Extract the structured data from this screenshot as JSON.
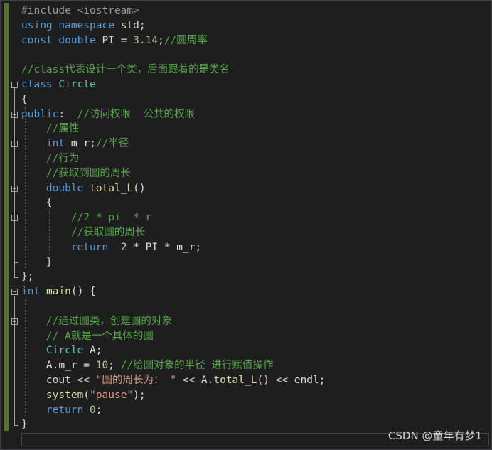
{
  "code_lines": [
    [
      {
        "t": "#include <iostream>",
        "c": "pp"
      }
    ],
    [
      {
        "t": "using",
        "c": "kw"
      },
      {
        "t": " ",
        "c": "tx"
      },
      {
        "t": "namespace",
        "c": "kw"
      },
      {
        "t": " std;",
        "c": "tx"
      }
    ],
    [
      {
        "t": "const",
        "c": "kw"
      },
      {
        "t": " ",
        "c": "tx"
      },
      {
        "t": "double",
        "c": "kw"
      },
      {
        "t": " PI = ",
        "c": "tx"
      },
      {
        "t": "3.14",
        "c": "nu"
      },
      {
        "t": ";",
        "c": "tx"
      },
      {
        "t": "//圆周率",
        "c": "cm"
      }
    ],
    [],
    [
      {
        "t": "//class代表设计一个类，后面跟着的是类名",
        "c": "cm"
      }
    ],
    [
      {
        "t": "class",
        "c": "kw"
      },
      {
        "t": " ",
        "c": "tx"
      },
      {
        "t": "Circle",
        "c": "ty"
      }
    ],
    [
      {
        "t": "{",
        "c": "tx"
      }
    ],
    [
      {
        "t": "public",
        "c": "kw"
      },
      {
        "t": ":  ",
        "c": "tx"
      },
      {
        "t": "//访问权限  公共的权限",
        "c": "cm"
      }
    ],
    [
      {
        "t": "    //属性",
        "c": "cm"
      }
    ],
    [
      {
        "t": "    ",
        "c": "tx"
      },
      {
        "t": "int",
        "c": "kw"
      },
      {
        "t": " m_r;",
        "c": "tx"
      },
      {
        "t": "//半径",
        "c": "cm"
      }
    ],
    [
      {
        "t": "    //行为",
        "c": "cm"
      }
    ],
    [
      {
        "t": "    //获取到圆的周长",
        "c": "cm"
      }
    ],
    [
      {
        "t": "    ",
        "c": "tx"
      },
      {
        "t": "double",
        "c": "kw"
      },
      {
        "t": " ",
        "c": "tx"
      },
      {
        "t": "total_L",
        "c": "fn"
      },
      {
        "t": "()",
        "c": "tx"
      }
    ],
    [
      {
        "t": "    {",
        "c": "tx"
      }
    ],
    [
      {
        "t": "        //2 * pi  * r",
        "c": "cm"
      }
    ],
    [
      {
        "t": "        //获取圆的周长",
        "c": "cm"
      }
    ],
    [
      {
        "t": "        ",
        "c": "tx"
      },
      {
        "t": "return",
        "c": "kw"
      },
      {
        "t": "  ",
        "c": "tx"
      },
      {
        "t": "2",
        "c": "nu"
      },
      {
        "t": " * PI * m_r;",
        "c": "tx"
      }
    ],
    [
      {
        "t": "    }",
        "c": "tx"
      }
    ],
    [
      {
        "t": "};",
        "c": "tx"
      }
    ],
    [
      {
        "t": "int",
        "c": "kw"
      },
      {
        "t": " ",
        "c": "tx"
      },
      {
        "t": "main",
        "c": "fn"
      },
      {
        "t": "() {",
        "c": "tx"
      }
    ],
    [],
    [
      {
        "t": "    //通过圆类，创建圆的对象",
        "c": "cm"
      }
    ],
    [
      {
        "t": "    // A就是一个具体的圆",
        "c": "cm"
      }
    ],
    [
      {
        "t": "    ",
        "c": "tx"
      },
      {
        "t": "Circle",
        "c": "ty"
      },
      {
        "t": " A;",
        "c": "tx"
      }
    ],
    [
      {
        "t": "    A.m_r = ",
        "c": "tx"
      },
      {
        "t": "10",
        "c": "nu"
      },
      {
        "t": "; ",
        "c": "tx"
      },
      {
        "t": "//给圆对象的半径 进行赋值操作",
        "c": "cm"
      }
    ],
    [
      {
        "t": "    cout << ",
        "c": "tx"
      },
      {
        "t": "\"圆的周长为： \"",
        "c": "st"
      },
      {
        "t": " << A.",
        "c": "tx"
      },
      {
        "t": "total_L",
        "c": "fn"
      },
      {
        "t": "() << endl;",
        "c": "tx"
      }
    ],
    [
      {
        "t": "    ",
        "c": "tx"
      },
      {
        "t": "system",
        "c": "fn"
      },
      {
        "t": "(",
        "c": "tx"
      },
      {
        "t": "\"pause\"",
        "c": "st"
      },
      {
        "t": ");",
        "c": "tx"
      }
    ],
    [
      {
        "t": "    ",
        "c": "tx"
      },
      {
        "t": "return",
        "c": "kw"
      },
      {
        "t": " ",
        "c": "tx"
      },
      {
        "t": "0",
        "c": "nu"
      },
      {
        "t": ";",
        "c": "tx"
      }
    ],
    [
      {
        "t": "}",
        "c": "tx"
      }
    ]
  ],
  "watermark": "CSDN @童年有梦1",
  "colors": {
    "background": "#1e1e1e",
    "keyword": "#569cd6",
    "comment": "#57a64a",
    "type": "#4ec9b0",
    "function": "#dcdcaa",
    "number": "#b5cea8",
    "string": "#d69d85",
    "text": "#dcdcdc",
    "change_bar": "#577430"
  }
}
